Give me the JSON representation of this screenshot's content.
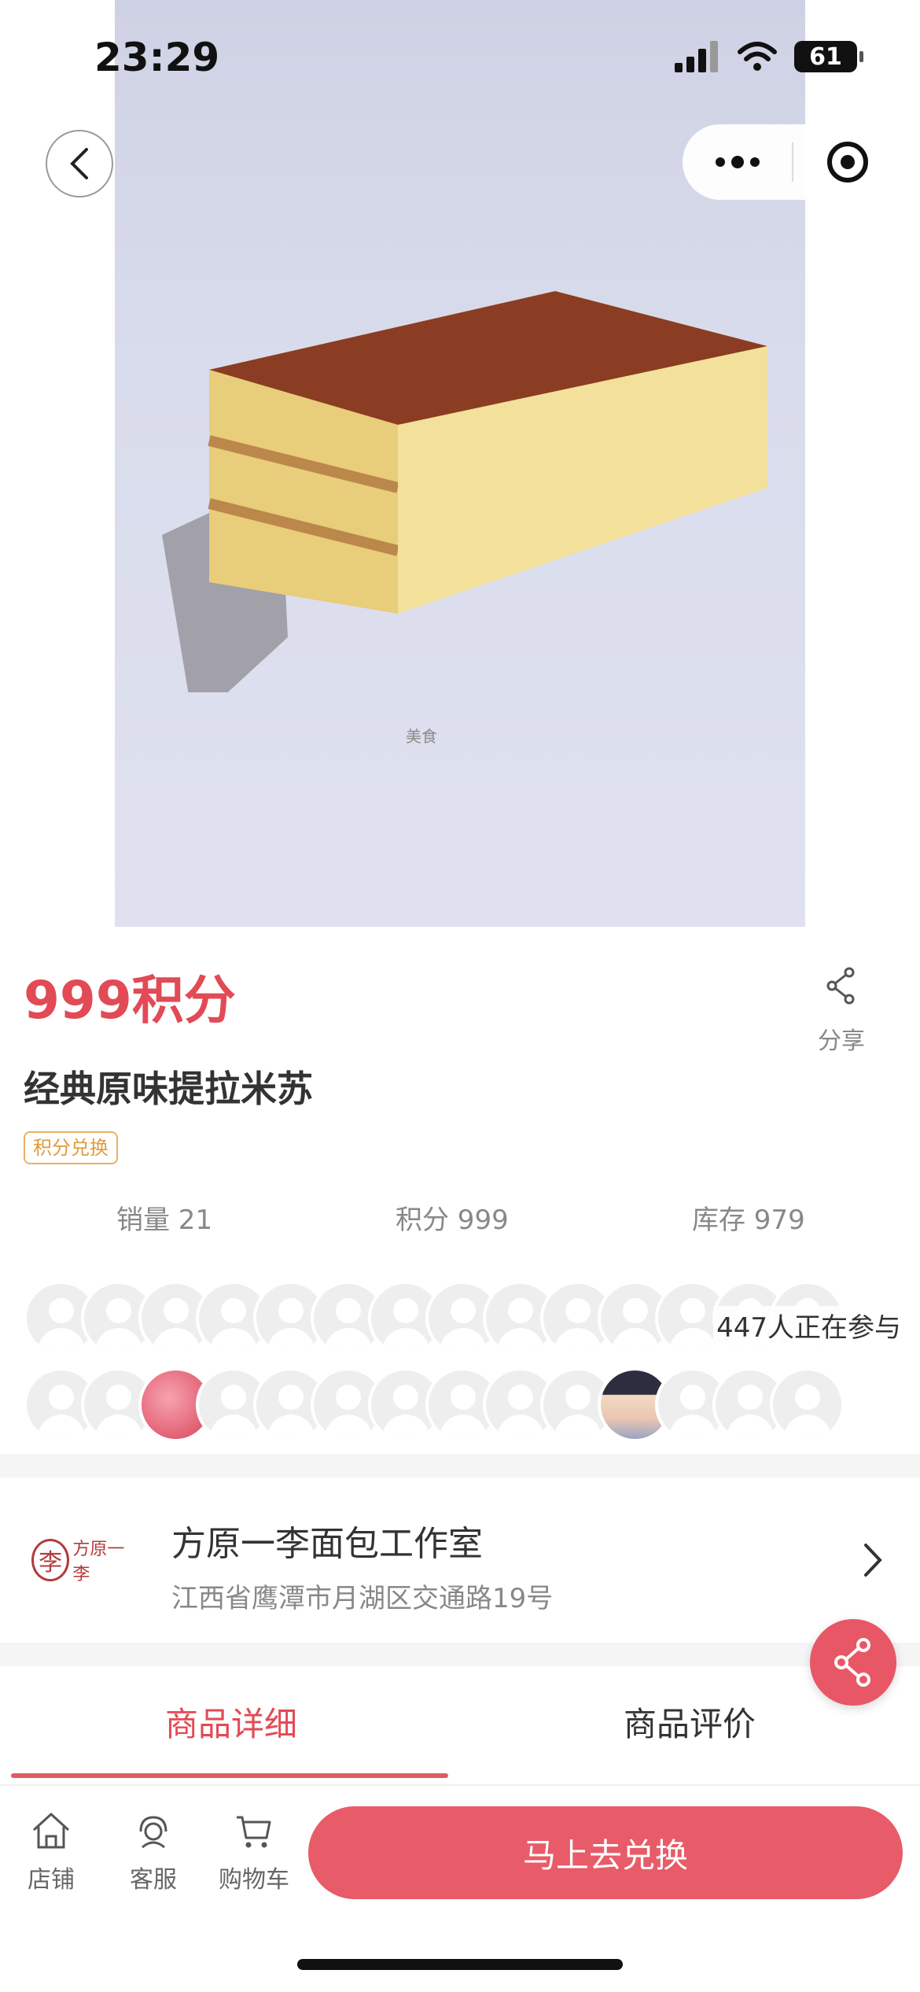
{
  "status_bar": {
    "time": "23:29",
    "battery": "61"
  },
  "hero": {
    "watermark_text": "美食"
  },
  "product": {
    "price": "999积分",
    "share_label": "分享",
    "title": "经典原味提拉米苏",
    "tag": "积分兑换",
    "stats": {
      "sales": "销量 21",
      "points": "积分 999",
      "stock": "库存 979"
    },
    "participants": "447人正在参与"
  },
  "store": {
    "logo_text": "方原一李",
    "name": "方原一李面包工作室",
    "address": "江西省鹰潭市月湖区交通路19号"
  },
  "tabs": {
    "detail": "商品详细",
    "review": "商品评价",
    "active": "商品详细"
  },
  "bottom_bar": {
    "store_label": "店铺",
    "service_label": "客服",
    "cart_label": "购物车",
    "exchange_button": "马上去兑换"
  },
  "colors": {
    "accent": "#e24a55",
    "button": "#e85b68",
    "tag_border": "#e9b26a"
  },
  "icons": [
    "back-icon",
    "more-icon",
    "close-capsule-icon",
    "share-icon",
    "chevron-right-icon",
    "store-icon",
    "service-icon",
    "cart-icon"
  ]
}
